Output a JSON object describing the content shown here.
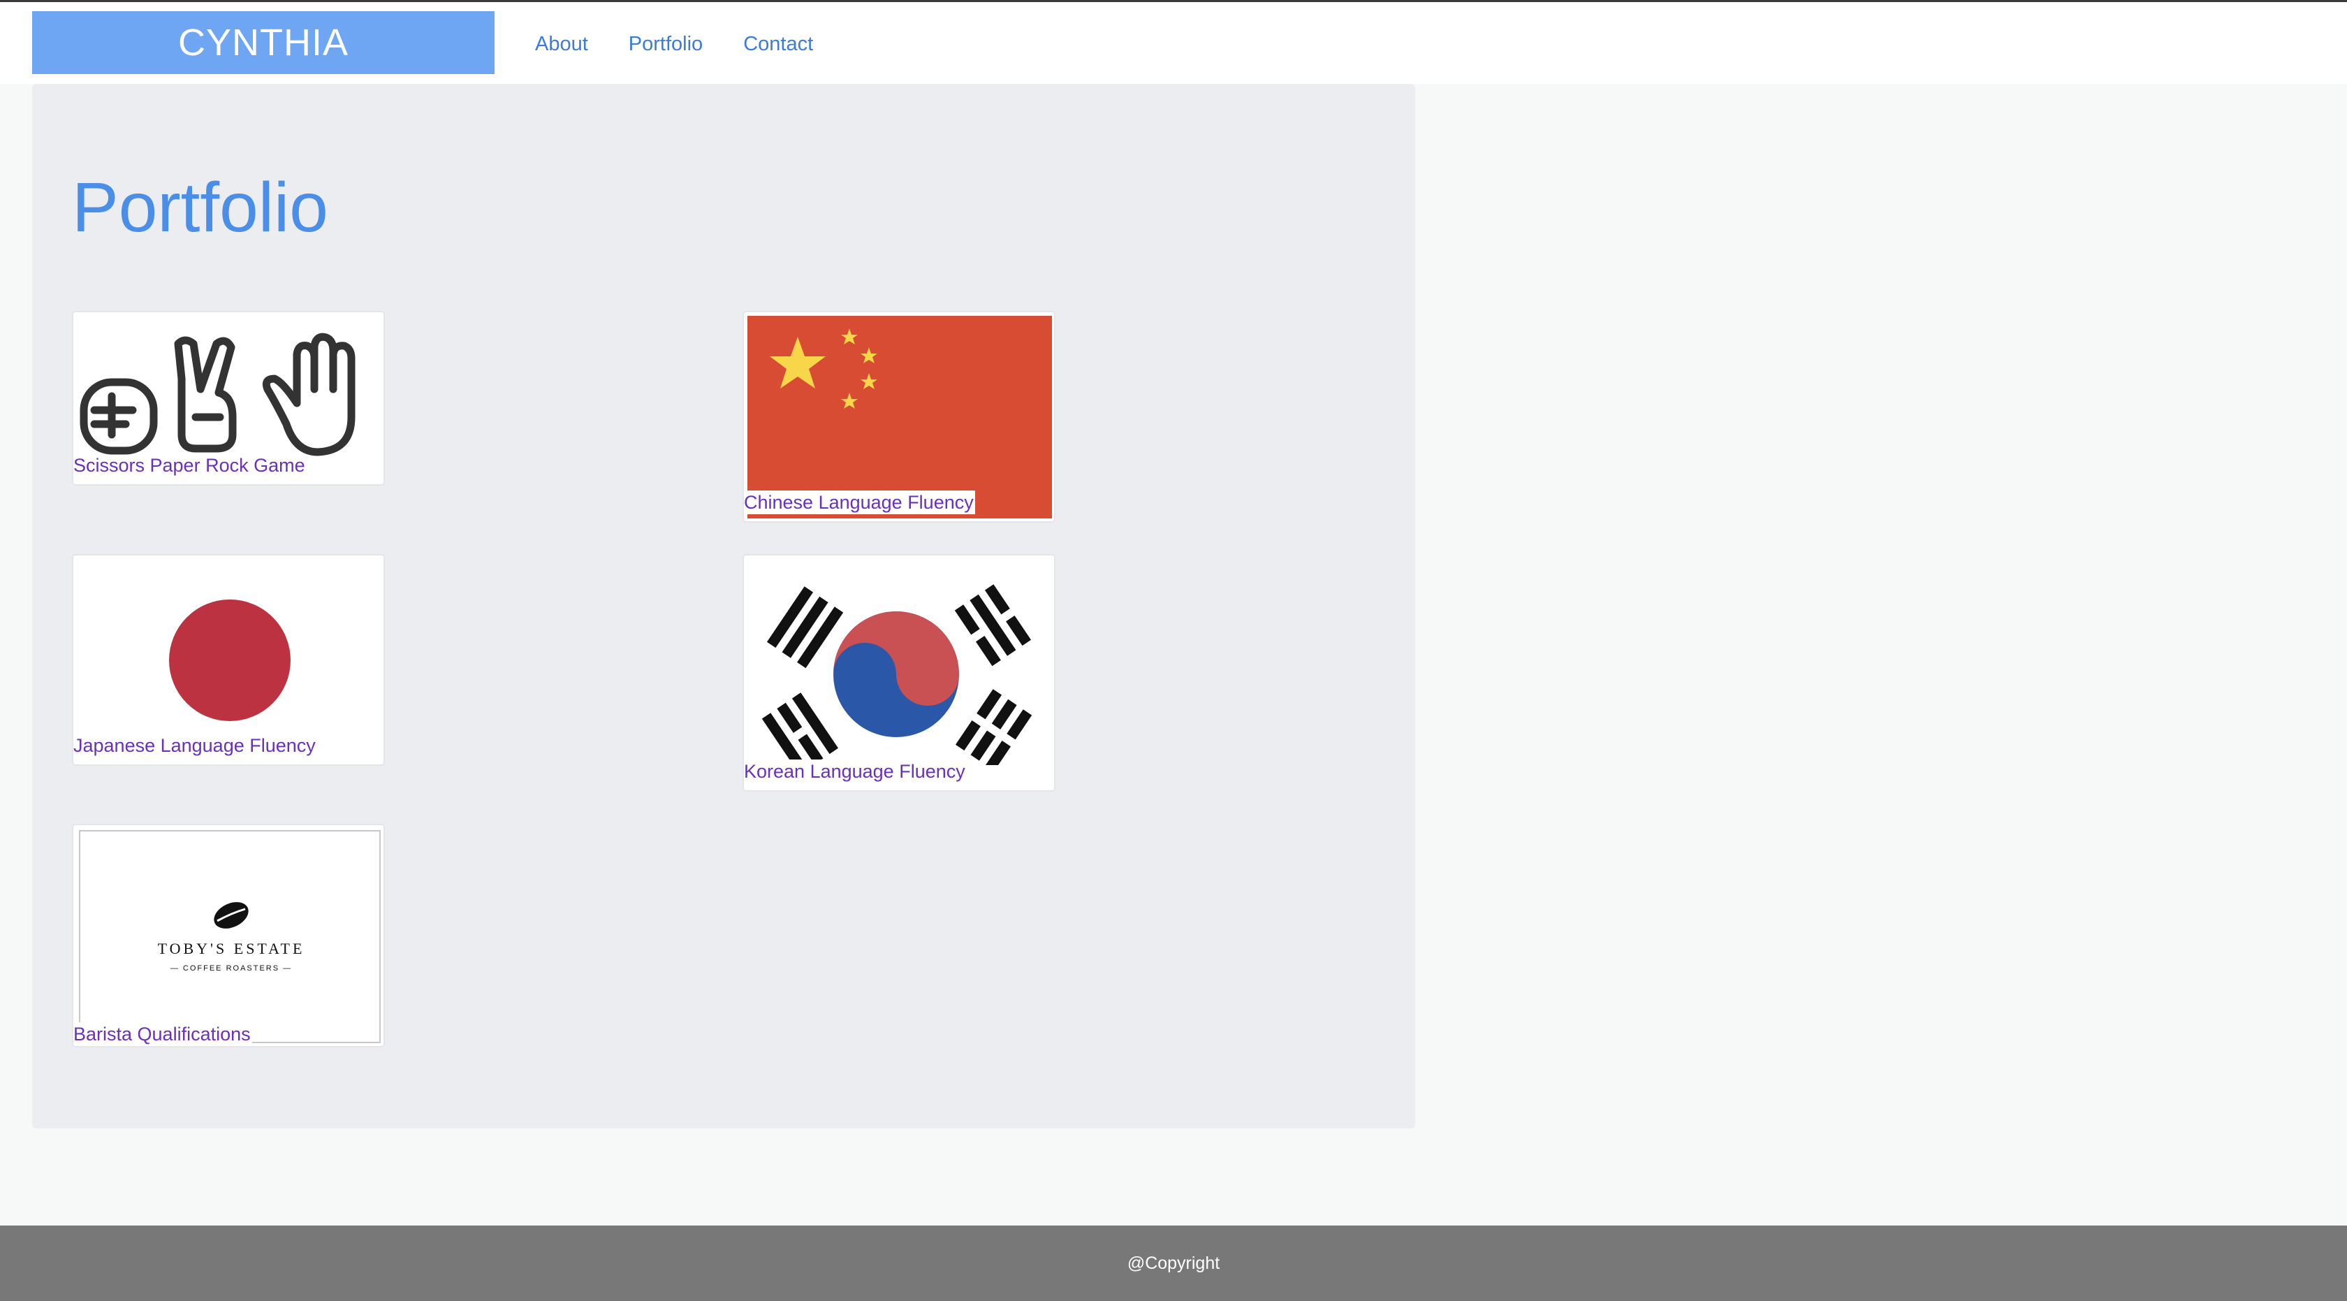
{
  "header": {
    "brand": "CYNTHIA",
    "nav": [
      "About",
      "Portfolio",
      "Contact"
    ]
  },
  "main": {
    "title": "Portfolio",
    "items": [
      {
        "label": "Scissors Paper Rock Game",
        "image": "rock-paper-scissors-hands-icon"
      },
      {
        "label": "Chinese Language Fluency",
        "image": "china-flag"
      },
      {
        "label": "Japanese Language Fluency",
        "image": "japan-flag"
      },
      {
        "label": "Korean Language Fluency",
        "image": "south-korea-flag"
      },
      {
        "label": "Barista Qualifications",
        "image": "tobys-estate-logo",
        "logo_text": "TOBY'S ESTATE",
        "logo_subtext": "— COFFEE ROASTERS —"
      }
    ]
  },
  "footer": {
    "text": "@Copyright"
  },
  "colors": {
    "brand_bg": "#6fa6f4",
    "link": "#3a7be0",
    "title": "#4a8ee8",
    "card_label": "#6a2fbf",
    "footer_bg": "#787878"
  }
}
